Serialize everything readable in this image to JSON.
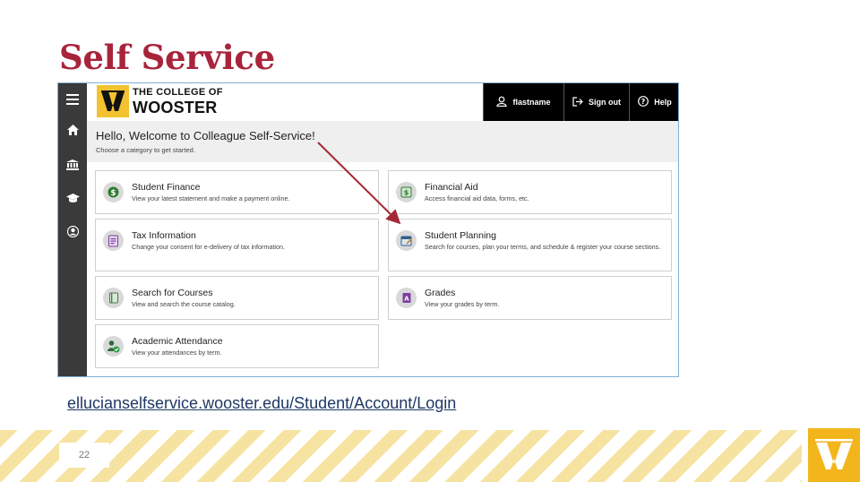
{
  "slide": {
    "title": "Self Service",
    "page_number": "22",
    "url": "ellucianselfservice.wooster.edu/Student/Account/Login"
  },
  "colors": {
    "title": "#a8243a",
    "brand_gold": "#f2c230",
    "rail": "#3a3a3a",
    "topbar_buttons": "#000000",
    "arrow": "#a32a35",
    "link": "#1f3864"
  },
  "sidebar": {
    "items": [
      {
        "icon": "menu-icon"
      },
      {
        "icon": "home-icon"
      },
      {
        "icon": "bank-icon"
      },
      {
        "icon": "graduation-cap-icon"
      },
      {
        "icon": "user-icon"
      }
    ]
  },
  "header": {
    "logo_line1": "THE COLLEGE OF",
    "logo_line2": "WOOSTER",
    "user_label": "flastname",
    "signout_label": "Sign out",
    "help_label": "Help"
  },
  "welcome": {
    "title": "Hello, Welcome to Colleague Self-Service!",
    "subtitle": "Choose a category to get started."
  },
  "cards": [
    {
      "title": "Student Finance",
      "desc": "View your latest statement and make a payment online.",
      "icon": "dollar-icon"
    },
    {
      "title": "Financial Aid",
      "desc": "Access financial aid data, forms, etc.",
      "icon": "money-icon"
    },
    {
      "title": "Tax Information",
      "desc": "Change your consent for e-delivery of tax information.",
      "icon": "tax-form-icon"
    },
    {
      "title": "Student Planning",
      "desc": "Search for courses, plan your terms, and schedule & register your course sections.",
      "icon": "calendar-icon"
    },
    {
      "title": "Search for Courses",
      "desc": "View and search the course catalog.",
      "icon": "book-icon"
    },
    {
      "title": "Grades",
      "desc": "View your grades by term.",
      "icon": "grade-icon"
    },
    {
      "title": "Academic Attendance",
      "desc": "View your attendances by term.",
      "icon": "attendance-icon"
    }
  ]
}
